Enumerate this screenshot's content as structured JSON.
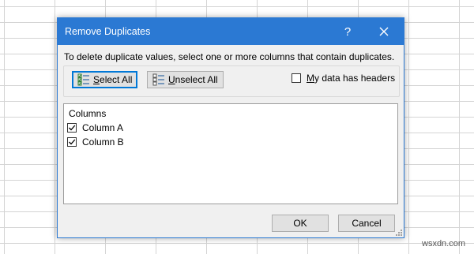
{
  "dialog": {
    "title": "Remove Duplicates",
    "help_glyph": "?",
    "instruction": "To delete duplicate values, select one or more columns that contain duplicates.",
    "select_all": {
      "hotkey": "S",
      "rest": "elect All"
    },
    "unselect_all": {
      "hotkey": "U",
      "rest": "nselect All"
    },
    "headers_checkbox": {
      "hotkey": "M",
      "rest": "y data has headers",
      "checked": false
    },
    "columns_title": "Columns",
    "columns": [
      {
        "label": "Column A",
        "checked": true
      },
      {
        "label": "Column B",
        "checked": true
      }
    ],
    "ok_label": "OK",
    "cancel_label": "Cancel"
  },
  "watermark": "wsxdn.com",
  "colors": {
    "titlebar": "#2b79d3",
    "dialog_bg": "#f0f0f0",
    "button_bg": "#e1e1e1",
    "grid_line": "#d4d4d4"
  }
}
